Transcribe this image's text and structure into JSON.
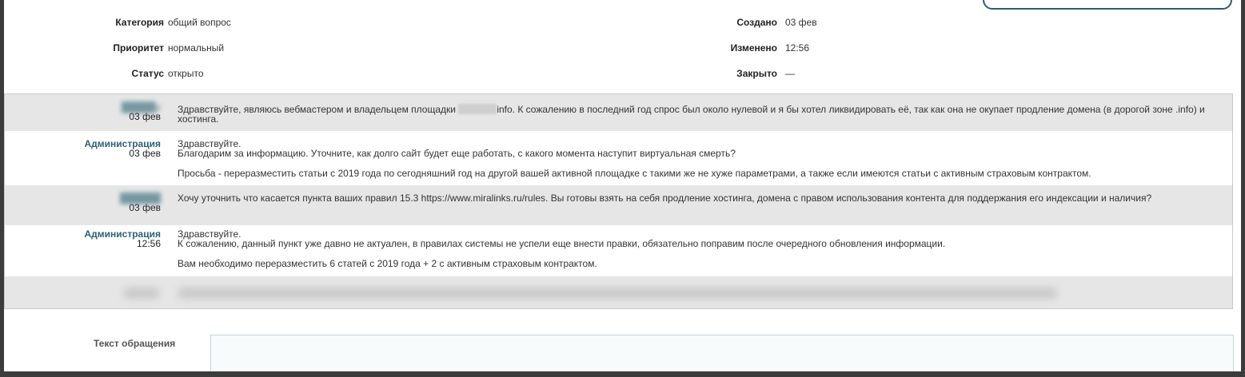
{
  "ticket": {
    "fields_left": [
      {
        "label": "Категория",
        "value": "общий вопрос"
      },
      {
        "label": "Приоритет",
        "value": "нормальный"
      },
      {
        "label": "Статус",
        "value": "открыто"
      }
    ],
    "fields_right": [
      {
        "label": "Создано",
        "value": "03 фев"
      },
      {
        "label": "Изменено",
        "value": "12:56"
      },
      {
        "label": "Закрыто",
        "value": "—"
      }
    ]
  },
  "messages": [
    {
      "author": "",
      "date": "03 фев",
      "paragraphs": [
        "Здравствуйте, являюсь вебмастером и владельцем площадки",
        "info. К сожалению в последний год спрос был около нулевой и я бы хотел ликвидировать её, так как она не окупает продление домена (в дорогой зоне .info) и хостинга."
      ]
    },
    {
      "author": "Администрация",
      "date": "03 фев",
      "paragraphs": [
        "Здравствуйте.",
        "Благодарим за информацию. Уточните, как долго сайт будет еще работать, с какого момента наступит виртуальная смерть?",
        "Просьба - переразместить статьи с 2019 года по сегодняшний год на другой вашей активной площадке с такими же не хуже параметрами, а также если имеются статьи с активным страховым контрактом."
      ]
    },
    {
      "author": "",
      "date": "03 фев",
      "paragraphs": [
        "Хочу уточнить что касается пункта ваших правил 15.3 https://www.miralinks.ru/rules. Вы готовы взять на себя продление хостинга, домена с правом использования контента для поддержания его индексации и наличия?"
      ]
    },
    {
      "author": "Администрация",
      "date": "12:56",
      "paragraphs": [
        "Здравствуйте.",
        "К сожалению, данный пункт уже давно не актуален, в правилах системы не успели еще внести правки, обязательно поправим после очередного обновления информации.",
        "Вам необходимо переразместить 6 статей с 2019 года + 2 с активным страховым контрактом."
      ]
    }
  ],
  "compose": {
    "label": "Текст обращения",
    "value": ""
  }
}
